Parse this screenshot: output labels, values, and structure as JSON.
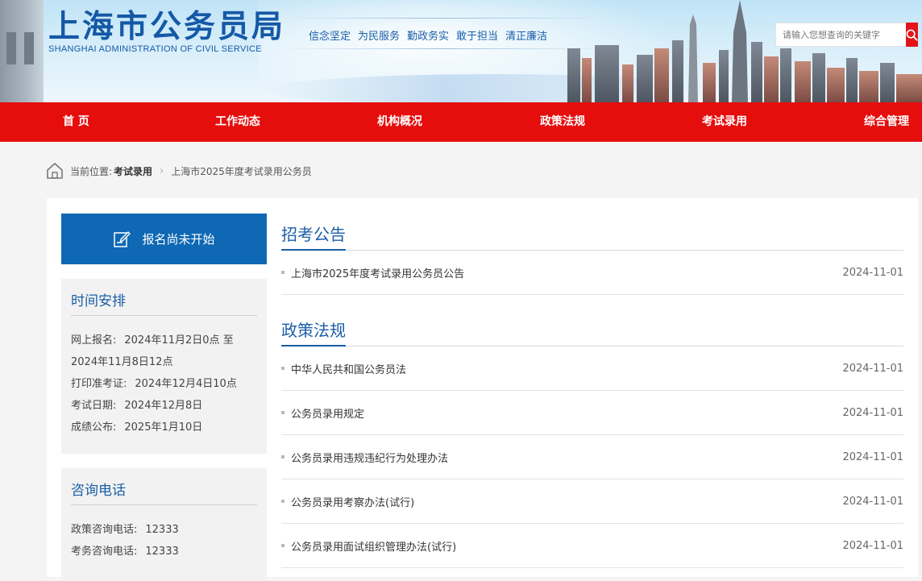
{
  "header": {
    "logo_cn": "上海市公务员局",
    "logo_en": "SHANGHAI ADMINISTRATION OF CIVIL SERVICE",
    "slogans": [
      "信念坚定",
      "为民服务",
      "勤政务实",
      "敢于担当",
      "清正廉洁"
    ],
    "search": {
      "placeholder": "请输入您想查询的关键字",
      "icon": "search-icon"
    }
  },
  "nav": {
    "items": [
      "首 页",
      "工作动态",
      "机构概况",
      "政策法规",
      "考试录用",
      "综合管理"
    ]
  },
  "breadcrumb": {
    "prefix": "当前位置:",
    "section": "考试录用",
    "current": "上海市2025年度考试录用公务员"
  },
  "sidebar": {
    "signup_label": "报名尚未开始",
    "schedule": {
      "title": "时间安排",
      "rows": [
        {
          "label": "网上报名:",
          "value": "2024年11月2日0点 至"
        },
        {
          "label": "",
          "value": "2024年11月8日12点"
        },
        {
          "label": "打印准考证:",
          "value": "2024年12月4日10点"
        },
        {
          "label": "考试日期:",
          "value": "2024年12月8日"
        },
        {
          "label": "成绩公布:",
          "value": "2025年1月10日"
        }
      ]
    },
    "phone": {
      "title": "咨询电话",
      "rows": [
        {
          "label": "政策咨询电话:",
          "value": "12333"
        },
        {
          "label": "考务咨询电话:",
          "value": "12333"
        }
      ]
    }
  },
  "notice": {
    "title": "招考公告",
    "items": [
      {
        "title": "上海市2025年度考试录用公务员公告",
        "date": "2024-11-01"
      }
    ]
  },
  "policy": {
    "title": "政策法规",
    "items": [
      {
        "title": "中华人民共和国公务员法",
        "date": "2024-11-01"
      },
      {
        "title": "公务员录用规定",
        "date": "2024-11-01"
      },
      {
        "title": "公务员录用违规违纪行为处理办法",
        "date": "2024-11-01"
      },
      {
        "title": "公务员录用考察办法(试行)",
        "date": "2024-11-01"
      },
      {
        "title": "公务员录用面试组织管理办法(试行)",
        "date": "2024-11-01"
      }
    ]
  },
  "colors": {
    "nav_red": "#e60d0d",
    "brand_blue": "#1a5ea8",
    "button_blue": "#0f68b4"
  }
}
